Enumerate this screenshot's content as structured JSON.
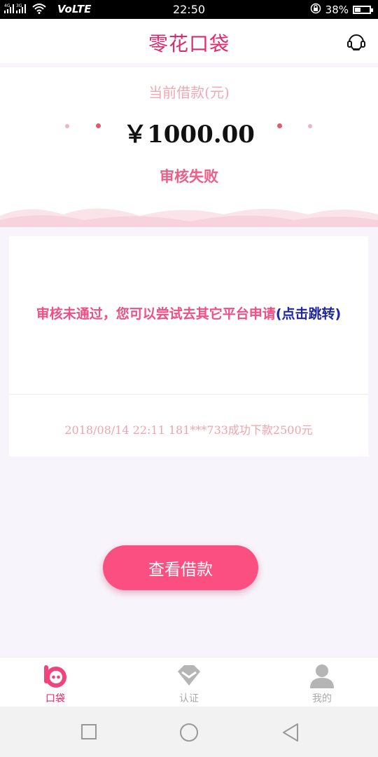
{
  "status_bar": {
    "network_1": "4G",
    "network_2": "3G",
    "volte": "VoLTE",
    "time": "22:50",
    "battery_percent": "38%",
    "battery_level": 0.38
  },
  "header": {
    "title": "零花口袋",
    "support_icon": "headset-icon"
  },
  "loan": {
    "label": "当前借款(元)",
    "amount": "￥1000.00",
    "status": "审核失败"
  },
  "notice": {
    "message": "审核未通过，您可以尝试去其它平台申请",
    "link": "(点击跳转)",
    "ticker": "2018/08/14 22:11 181***733成功下款2500元"
  },
  "actions": {
    "view_loan_label": "查看借款"
  },
  "tabs": [
    {
      "label": "口袋",
      "icon": "pocket-icon",
      "active": true
    },
    {
      "label": "认证",
      "icon": "diamond-icon",
      "active": false
    },
    {
      "label": "我的",
      "icon": "person-icon",
      "active": false
    }
  ],
  "colors": {
    "brand": "#e0286c",
    "accent": "#fb4f82",
    "link": "#1d26a3",
    "inactive": "#aaaaaa"
  }
}
